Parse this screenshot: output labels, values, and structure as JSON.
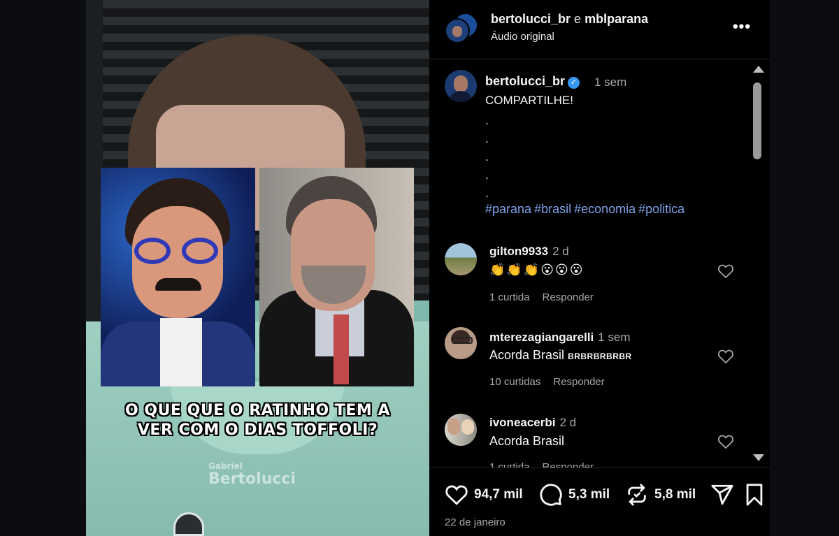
{
  "video": {
    "caption_line1": "O QUE QUE O RATINHO TEM A",
    "caption_line2": "VER COM O DIAS TOFFOLI?",
    "watermark_top": "Gabriel",
    "watermark_bottom": "Bertolucci"
  },
  "header": {
    "user1": "bertolucci_br",
    "conjunction": "e",
    "user2": "mblparana",
    "audio": "Áudio original",
    "more_icon": "•••"
  },
  "post": {
    "user": "bertolucci_br",
    "verified_icon": "✓",
    "time": "1 sem",
    "text": "COMPARTILHE!",
    "dots": [
      ".",
      ".",
      ".",
      ".",
      "."
    ],
    "hashtags": [
      "#parana",
      "#brasil",
      "#economia",
      "#politica"
    ]
  },
  "comments": [
    {
      "user": "gilton9933",
      "time": "2 d",
      "text": "👏👏👏😮😮😮",
      "likes": "1 curtida",
      "reply": "Responder"
    },
    {
      "user": "mterezagiangarelli",
      "time": "1 sem",
      "text": "Acorda Brasil",
      "text_extra": "BRBRBRBRBR",
      "likes": "10 curtidas",
      "reply": "Responder"
    },
    {
      "user": "ivoneacerbi",
      "time": "2 d",
      "text": "Acorda Brasil",
      "likes": "1 curtida",
      "reply": "Responder"
    }
  ],
  "actions": {
    "likes": "94,7 mil",
    "comments": "5,3 mil",
    "reposts": "5,8 mil",
    "date": "22 de janeiro"
  },
  "icons": {
    "like": "heart-icon",
    "comment": "comment-bubble-icon",
    "repost": "repost-icon",
    "share": "send-icon",
    "save": "bookmark-icon"
  },
  "colors": {
    "hashtag": "#7ea0e8",
    "verified": "#3897f0",
    "background": "#000000"
  }
}
